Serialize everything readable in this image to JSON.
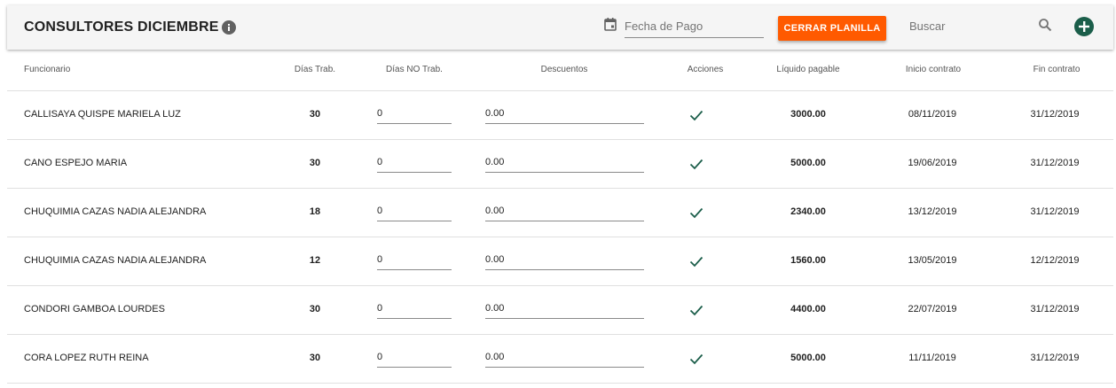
{
  "toolbar": {
    "title": "CONSULTORES DICIEMBRE",
    "info_icon": "info-icon",
    "date_icon": "calendar-icon",
    "date_placeholder": "Fecha de Pago",
    "close_button": "CERRAR PLANILLA",
    "search_placeholder": "Buscar",
    "search_icon": "search-icon",
    "add_icon": "add-circle-icon",
    "colors": {
      "accent_button": "#ff5a00",
      "add_icon": "#1b5e4a",
      "check": "#1b5e4a"
    }
  },
  "table": {
    "headers": [
      "Funcionario",
      "Días Trab.",
      "Días NO Trab.",
      "Descuentos",
      "Acciones",
      "Líquido pagable",
      "Inicio contrato",
      "Fin contrato"
    ],
    "action_icon": "check-icon",
    "rows": [
      {
        "name": "CALLISAYA QUISPE MARIELA LUZ",
        "dias_trab": "30",
        "dias_no_trab": "0",
        "descuentos": "0.00",
        "liquido": "3000.00",
        "inicio": "08/11/2019",
        "fin": "31/12/2019"
      },
      {
        "name": "CANO ESPEJO MARIA",
        "dias_trab": "30",
        "dias_no_trab": "0",
        "descuentos": "0.00",
        "liquido": "5000.00",
        "inicio": "19/06/2019",
        "fin": "31/12/2019"
      },
      {
        "name": "CHUQUIMIA CAZAS NADIA ALEJANDRA",
        "dias_trab": "18",
        "dias_no_trab": "0",
        "descuentos": "0.00",
        "liquido": "2340.00",
        "inicio": "13/12/2019",
        "fin": "31/12/2019"
      },
      {
        "name": "CHUQUIMIA CAZAS NADIA ALEJANDRA",
        "dias_trab": "12",
        "dias_no_trab": "0",
        "descuentos": "0.00",
        "liquido": "1560.00",
        "inicio": "13/05/2019",
        "fin": "12/12/2019"
      },
      {
        "name": "CONDORI GAMBOA LOURDES",
        "dias_trab": "30",
        "dias_no_trab": "0",
        "descuentos": "0.00",
        "liquido": "4400.00",
        "inicio": "22/07/2019",
        "fin": "31/12/2019"
      },
      {
        "name": "CORA LOPEZ RUTH REINA",
        "dias_trab": "30",
        "dias_no_trab": "0",
        "descuentos": "0.00",
        "liquido": "5000.00",
        "inicio": "11/11/2019",
        "fin": "31/12/2019"
      }
    ]
  }
}
